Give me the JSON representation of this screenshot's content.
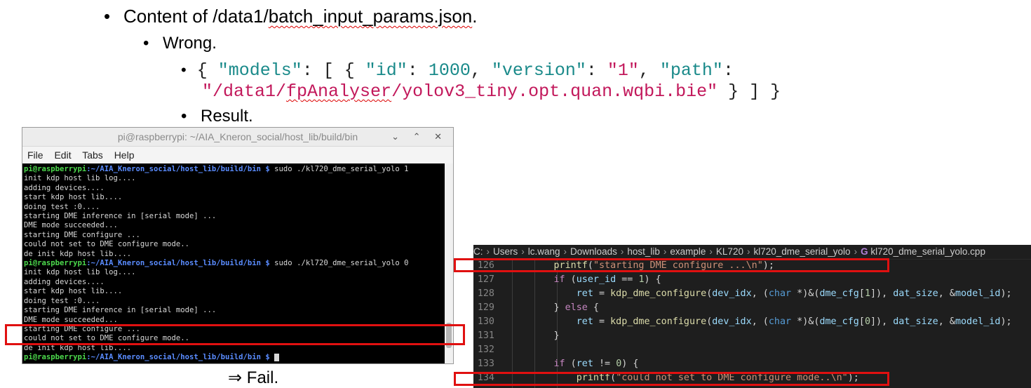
{
  "slide": {
    "bullet1_prefix": "Content of /data1/",
    "bullet1_file": "batch_input_params.json",
    "bullet1_suffix": ".",
    "bullet2": "Wrong.",
    "json_line1": {
      "open1": "{ ",
      "k_models": "\"models\"",
      "p1": ": [ { ",
      "k_id": "\"id\"",
      "p2": ": ",
      "v_id": "1000",
      "p3": ", ",
      "k_version": "\"version\"",
      "p4": ": ",
      "v_version": "\"1\"",
      "p5": ", ",
      "k_path": "\"path\"",
      "p6": ":"
    },
    "json_line2": {
      "v_path_a": "\"/data1/",
      "v_path_b": "fpAnalyser",
      "v_path_c": "/yolov3_tiny.opt.quan.wqbi.bie\"",
      "close": " } ] }"
    },
    "bullet3": "Result.",
    "fail": "⇒ Fail."
  },
  "terminal": {
    "title": "pi@raspberrypi: ~/AIA_Kneron_social/host_lib/build/bin",
    "controls": "⌄ ⌃ ✕",
    "menu": [
      "File",
      "Edit",
      "Tabs",
      "Help"
    ],
    "prompt_user": "pi@raspberrypi",
    "prompt_path": ":~/AIA_Kneron_social/host_lib/build/bin $",
    "cmd1": " sudo ./kl720_dme_serial_yolo 1",
    "cmd2": " sudo ./kl720_dme_serial_yolo 0",
    "block1": [
      "init kdp host lib log....",
      "adding devices....",
      "start kdp host lib....",
      "doing test :0....",
      "starting DME inference in [serial mode] ...",
      "DME mode succeeded...",
      "starting DME configure ...",
      "could not set to DME configure mode..",
      "de init kdp host lib...."
    ],
    "block2": [
      "init kdp host lib log....",
      "adding devices....",
      "start kdp host lib....",
      "doing test :0....",
      "starting DME inference in [serial mode] ...",
      "DME mode succeeded...",
      "starting DME configure ...",
      "could not set to DME configure mode..",
      "de init kdp host lib...."
    ]
  },
  "editor": {
    "breadcrumb": [
      "C:",
      "Users",
      "lc.wang",
      "Downloads",
      "host_lib",
      "example",
      "KL720",
      "kl720_dme_serial_yolo",
      "kl720_dme_serial_yolo.cpp"
    ],
    "lines": {
      "n126": "126",
      "n127": "127",
      "n128": "128",
      "n129": "129",
      "n130": "130",
      "n131": "131",
      "n132": "132",
      "n133": "133",
      "n134": "134"
    },
    "code": {
      "printf": "printf",
      "str126": "\"starting DME configure ...\\n\"",
      "if": "if",
      "user_id": "user_id",
      "eq1": " == ",
      "one": "1",
      "ret": "ret",
      "kdp_fn": "kdp_dme_configure",
      "dev_idx": "dev_idx",
      "char": "char",
      "dme_cfg": "dme_cfg",
      "dat_size": "dat_size",
      "model_id": "model_id",
      "else": "else",
      "zero": "0",
      "neq": " != ",
      "str134": "\"could not set to DME configure mode..\\n\""
    }
  },
  "colors": {
    "highlight_box": "#e01010",
    "editor_bg": "#1e1e1e",
    "terminal_prompt": "#4cd94c",
    "terminal_path": "#5a8cff"
  }
}
